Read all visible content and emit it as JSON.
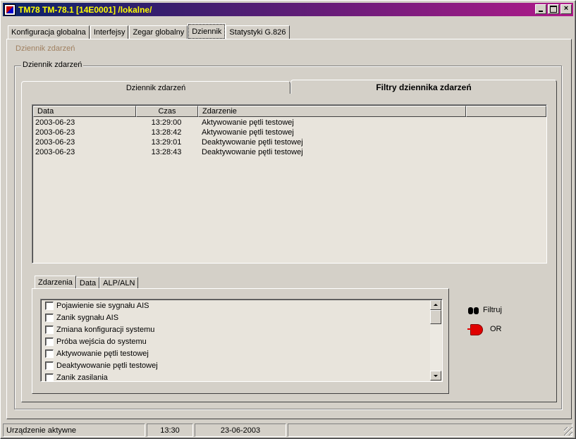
{
  "window": {
    "title": "TM78 TM-78.1 [14E0001] /lokalne/",
    "controls": {
      "minimize": "",
      "maximize": "",
      "close": "×"
    }
  },
  "top_tabs": [
    {
      "label": "Konfiguracja globalna",
      "active": false
    },
    {
      "label": "Interfejsy",
      "active": false
    },
    {
      "label": "Zegar globalny",
      "active": false
    },
    {
      "label": "Dziennik",
      "active": true
    },
    {
      "label": "Statystyki G.826",
      "active": false
    }
  ],
  "breadcrumb": "Dziennik zdarzeń",
  "group_title": "Dziennik zdarzeń",
  "mid_tabs": [
    {
      "label": "Dziennik zdarzeń",
      "active": false
    },
    {
      "label": "Filtry dziennika zdarzeń",
      "active": true
    }
  ],
  "event_list": {
    "columns": [
      "Data",
      "Czas",
      "Zdarzenie",
      ""
    ],
    "rows": [
      {
        "date": "2003-06-23",
        "time": "13:29:00",
        "event": "Aktywowanie pętli testowej"
      },
      {
        "date": "2003-06-23",
        "time": "13:28:42",
        "event": "Aktywowanie pętli testowej"
      },
      {
        "date": "2003-06-23",
        "time": "13:29:01",
        "event": "Deaktywowanie pętli testowej"
      },
      {
        "date": "2003-06-23",
        "time": "13:28:43",
        "event": "Deaktywowanie pętli testowej"
      }
    ]
  },
  "sub_tabs": [
    {
      "label": "Zdarzenia",
      "active": true
    },
    {
      "label": "Data",
      "active": false
    },
    {
      "label": "ALP/ALN",
      "active": false
    }
  ],
  "filter_events": [
    {
      "label": "Pojawienie sie sygnału AIS",
      "checked": false
    },
    {
      "label": "Zanik sygnału AIS",
      "checked": false
    },
    {
      "label": "Zmiana konfiguracji systemu",
      "checked": false
    },
    {
      "label": "Próba wejścia do systemu",
      "checked": false
    },
    {
      "label": "Aktywowanie pętli testowej",
      "checked": false
    },
    {
      "label": "Deaktywowanie pętli testowej",
      "checked": false
    },
    {
      "label": "Zanik zasilania",
      "checked": false
    }
  ],
  "actions": {
    "filter": {
      "label": "Filtruj",
      "icon": "binoculars-icon"
    },
    "logic": {
      "label": "OR",
      "icon": "or-gate-icon"
    }
  },
  "status_bar": {
    "status": "Urządzenie aktywne",
    "time": "13:30",
    "date": "23-06-2003"
  }
}
